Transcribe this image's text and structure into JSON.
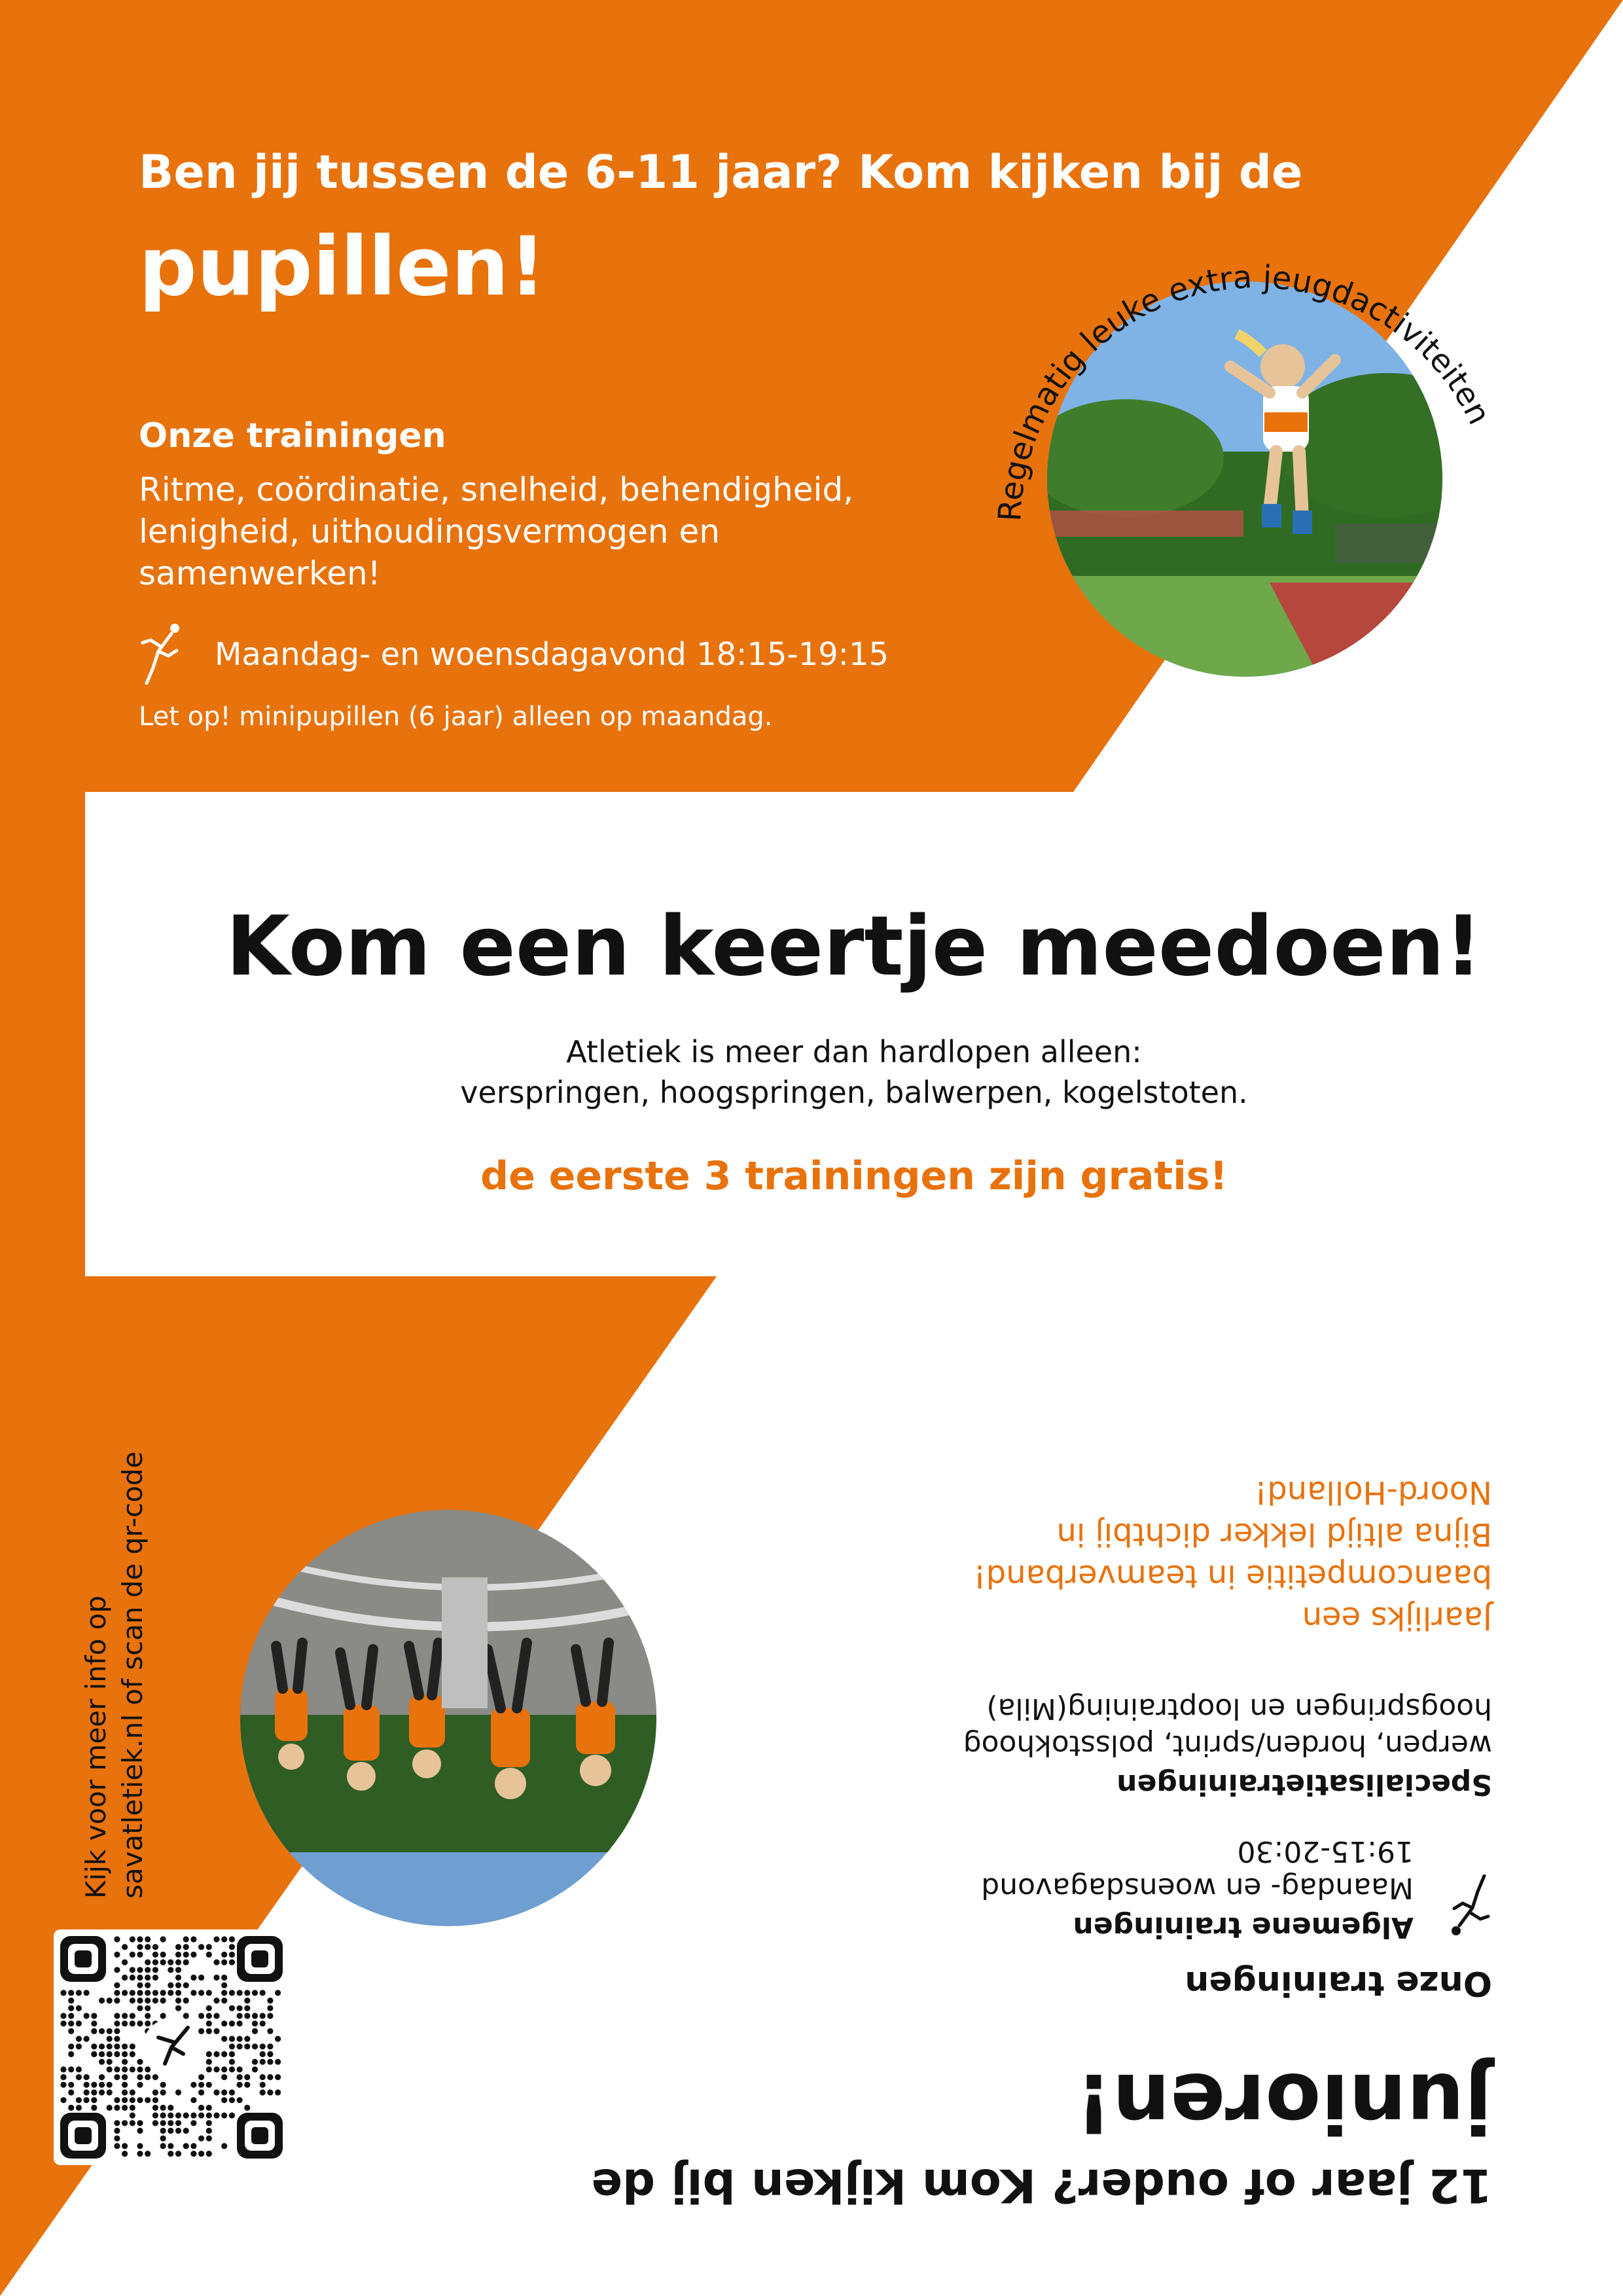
{
  "colors": {
    "brand_orange": "#e8720c",
    "white": "#ffffff",
    "black": "#111111"
  },
  "pupillen": {
    "intro": "Ben jij tussen de 6-11 jaar? Kom kijken bij de",
    "title": "pupillen!",
    "trainings_heading": "Onze trainingen",
    "trainings_text": "Ritme, coördinatie, snelheid, behendigheid, lenigheid, uithoudingsvermogen en samenwerken!",
    "schedule": "Maandag- en woensdagavond 18:15-19:15",
    "note": "Let op! minipupillen (6 jaar) alleen op maandag.",
    "badge_text": "Regelmatig leuke extra jeugdactiviteiten"
  },
  "middle": {
    "headline": "Kom een keertje meedoen!",
    "line1": "Atletiek is meer dan hardlopen alleen:",
    "line2": "verspringen, hoogspringen, balwerpen, kogelstoten.",
    "offer": "de eerste 3 trainingen zijn gratis!"
  },
  "junioren": {
    "intro": "12 jaar of ouder? Kom kijken bij de",
    "title": "junioren!",
    "trainings_heading": "Onze trainingen",
    "general_heading": "Algemene trainingen",
    "general_schedule_1": "Maandag- en woensdagavond",
    "general_schedule_2": "19:15-20:30",
    "specialist_heading": "Specialisatietrainingen",
    "specialist_text_1": "werpen, horden/sprint, polsstokhoog",
    "specialist_text_2": "hoogspringen en looptraining(Mila)",
    "competition_1": "Jaarlijks een",
    "competition_2": "baancompetitie in teamverband!",
    "competition_3": "Bijna altijd lekker dichtbij in",
    "competition_4": "Noord-Holland!"
  },
  "qr": {
    "caption_1": "Kijk voor meer info op",
    "caption_2": "savatletiek.nl of scan de qr-code"
  },
  "icons": {
    "athlete": "athlete-icon",
    "qr": "qr-code"
  }
}
